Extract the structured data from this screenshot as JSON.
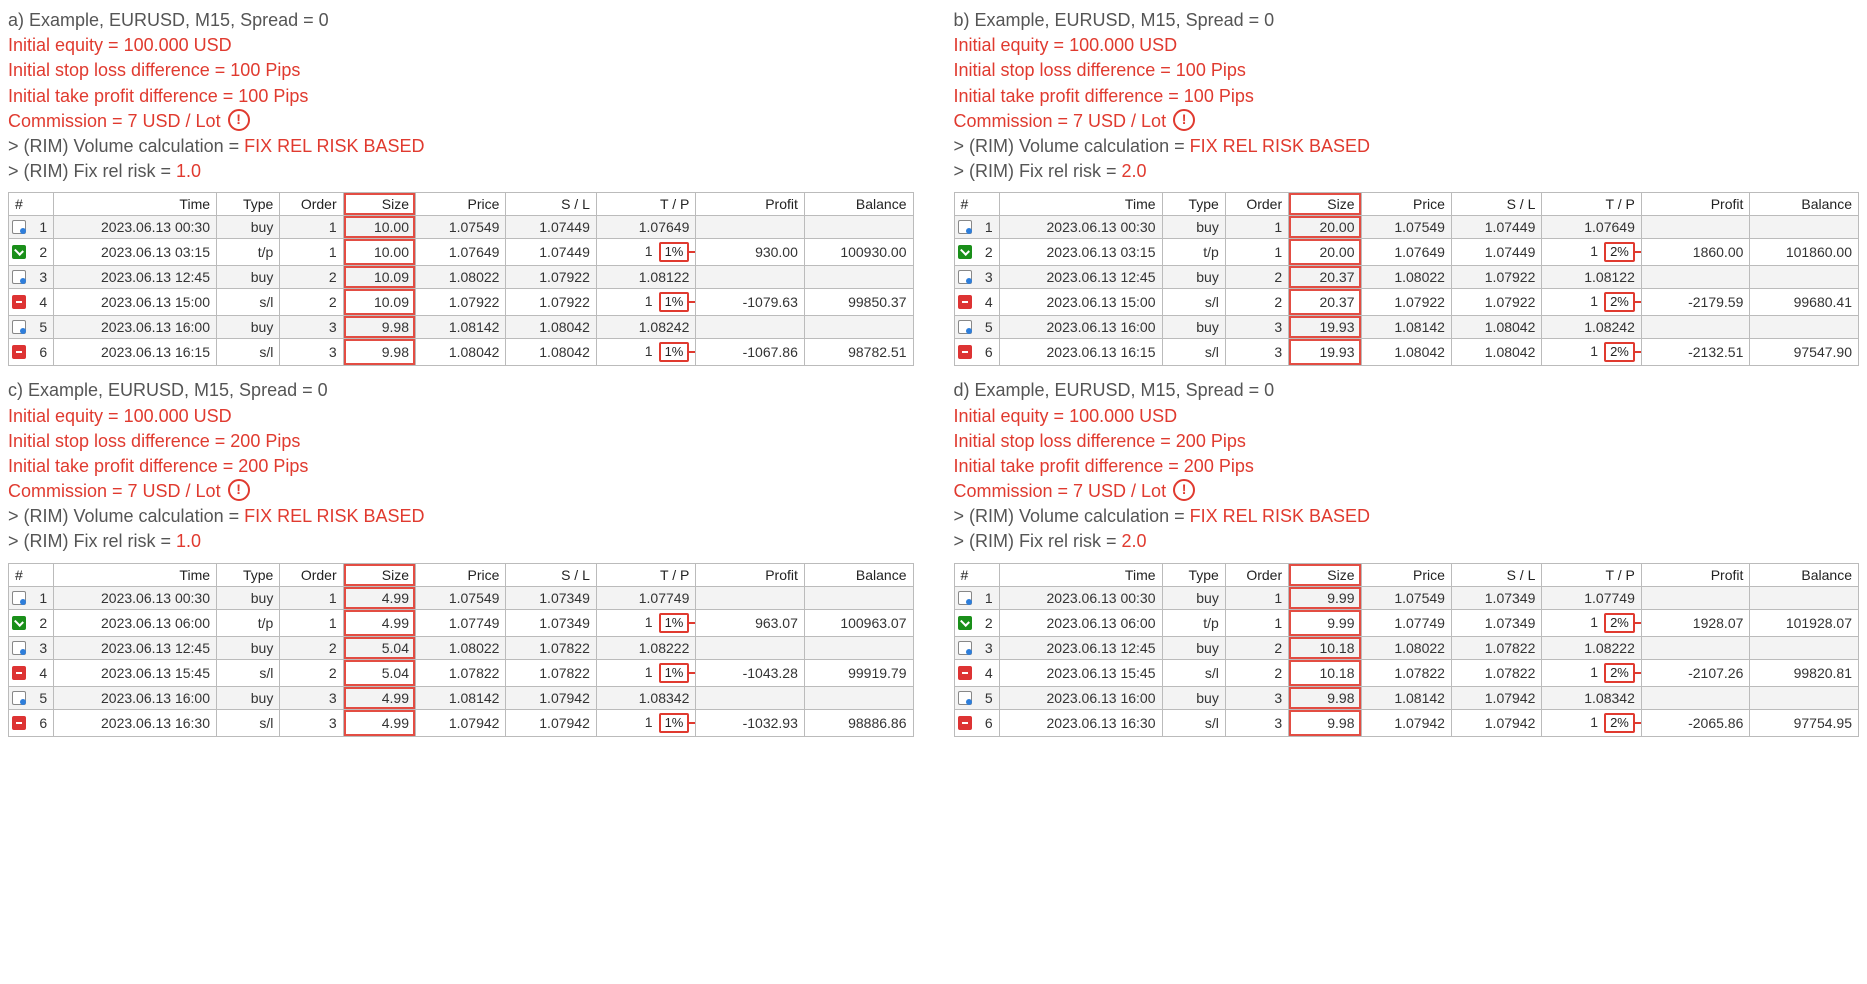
{
  "headers": [
    "#",
    "Time",
    "Type",
    "Order",
    "Size",
    "Price",
    "S / L",
    "T / P",
    "Profit",
    "Balance"
  ],
  "common_params": {
    "equity": "Initial equity = 100.000 USD",
    "commission": "Commission = 7 USD / Lot",
    "vol_prefix": "> (RIM) Volume calculation = ",
    "vol_value": "FIX REL RISK BASED",
    "risk_prefix": "> (RIM) Fix rel risk = "
  },
  "panels": [
    {
      "id": "a",
      "title": "a) Example, EURUSD, M15, Spread = 0",
      "sl_line": "Initial stop loss difference = 100 Pips",
      "tp_line": "Initial take profit difference = 100 Pips",
      "risk": "1.0",
      "pct": "1%",
      "rows": [
        {
          "i": 1,
          "time": "2023.06.13 00:30",
          "type": "buy",
          "ic": "buy",
          "order": "1",
          "size": "10.00",
          "price": "1.07549",
          "sl": "1.07449",
          "tp": "1.07649",
          "annot": false,
          "profit": "",
          "bal": ""
        },
        {
          "i": 2,
          "time": "2023.06.13 03:15",
          "type": "t/p",
          "ic": "tp",
          "order": "1",
          "size": "10.00",
          "price": "1.07649",
          "sl": "1.07449",
          "tp": "1",
          "annot": true,
          "profit": "930.00",
          "bal": "100930.00"
        },
        {
          "i": 3,
          "time": "2023.06.13 12:45",
          "type": "buy",
          "ic": "buy",
          "order": "2",
          "size": "10.09",
          "price": "1.08022",
          "sl": "1.07922",
          "tp": "1.08122",
          "annot": false,
          "profit": "",
          "bal": ""
        },
        {
          "i": 4,
          "time": "2023.06.13 15:00",
          "type": "s/l",
          "ic": "sl",
          "order": "2",
          "size": "10.09",
          "price": "1.07922",
          "sl": "1.07922",
          "tp": "1",
          "annot": true,
          "profit": "-1079.63",
          "bal": "99850.37"
        },
        {
          "i": 5,
          "time": "2023.06.13 16:00",
          "type": "buy",
          "ic": "buy",
          "order": "3",
          "size": "9.98",
          "price": "1.08142",
          "sl": "1.08042",
          "tp": "1.08242",
          "annot": false,
          "profit": "",
          "bal": ""
        },
        {
          "i": 6,
          "time": "2023.06.13 16:15",
          "type": "s/l",
          "ic": "sl",
          "order": "3",
          "size": "9.98",
          "price": "1.08042",
          "sl": "1.08042",
          "tp": "1",
          "annot": true,
          "profit": "-1067.86",
          "bal": "98782.51"
        }
      ]
    },
    {
      "id": "b",
      "title": "b) Example, EURUSD, M15, Spread = 0",
      "sl_line": "Initial stop loss difference = 100 Pips",
      "tp_line": "Initial take profit difference = 100 Pips",
      "risk": "2.0",
      "pct": "2%",
      "rows": [
        {
          "i": 1,
          "time": "2023.06.13 00:30",
          "type": "buy",
          "ic": "buy",
          "order": "1",
          "size": "20.00",
          "price": "1.07549",
          "sl": "1.07449",
          "tp": "1.07649",
          "annot": false,
          "profit": "",
          "bal": ""
        },
        {
          "i": 2,
          "time": "2023.06.13 03:15",
          "type": "t/p",
          "ic": "tp",
          "order": "1",
          "size": "20.00",
          "price": "1.07649",
          "sl": "1.07449",
          "tp": "1",
          "annot": true,
          "profit": "1860.00",
          "bal": "101860.00"
        },
        {
          "i": 3,
          "time": "2023.06.13 12:45",
          "type": "buy",
          "ic": "buy",
          "order": "2",
          "size": "20.37",
          "price": "1.08022",
          "sl": "1.07922",
          "tp": "1.08122",
          "annot": false,
          "profit": "",
          "bal": ""
        },
        {
          "i": 4,
          "time": "2023.06.13 15:00",
          "type": "s/l",
          "ic": "sl",
          "order": "2",
          "size": "20.37",
          "price": "1.07922",
          "sl": "1.07922",
          "tp": "1",
          "annot": true,
          "profit": "-2179.59",
          "bal": "99680.41"
        },
        {
          "i": 5,
          "time": "2023.06.13 16:00",
          "type": "buy",
          "ic": "buy",
          "order": "3",
          "size": "19.93",
          "price": "1.08142",
          "sl": "1.08042",
          "tp": "1.08242",
          "annot": false,
          "profit": "",
          "bal": ""
        },
        {
          "i": 6,
          "time": "2023.06.13 16:15",
          "type": "s/l",
          "ic": "sl",
          "order": "3",
          "size": "19.93",
          "price": "1.08042",
          "sl": "1.08042",
          "tp": "1",
          "annot": true,
          "profit": "-2132.51",
          "bal": "97547.90"
        }
      ]
    },
    {
      "id": "c",
      "title": "c) Example, EURUSD, M15, Spread = 0",
      "sl_line": "Initial stop loss difference = 200 Pips",
      "tp_line": "Initial take profit difference = 200 Pips",
      "risk": "1.0",
      "pct": "1%",
      "rows": [
        {
          "i": 1,
          "time": "2023.06.13 00:30",
          "type": "buy",
          "ic": "buy",
          "order": "1",
          "size": "4.99",
          "price": "1.07549",
          "sl": "1.07349",
          "tp": "1.07749",
          "annot": false,
          "profit": "",
          "bal": ""
        },
        {
          "i": 2,
          "time": "2023.06.13 06:00",
          "type": "t/p",
          "ic": "tp",
          "order": "1",
          "size": "4.99",
          "price": "1.07749",
          "sl": "1.07349",
          "tp": "1",
          "annot": true,
          "profit": "963.07",
          "bal": "100963.07"
        },
        {
          "i": 3,
          "time": "2023.06.13 12:45",
          "type": "buy",
          "ic": "buy",
          "order": "2",
          "size": "5.04",
          "price": "1.08022",
          "sl": "1.07822",
          "tp": "1.08222",
          "annot": false,
          "profit": "",
          "bal": ""
        },
        {
          "i": 4,
          "time": "2023.06.13 15:45",
          "type": "s/l",
          "ic": "sl",
          "order": "2",
          "size": "5.04",
          "price": "1.07822",
          "sl": "1.07822",
          "tp": "1",
          "annot": true,
          "profit": "-1043.28",
          "bal": "99919.79"
        },
        {
          "i": 5,
          "time": "2023.06.13 16:00",
          "type": "buy",
          "ic": "buy",
          "order": "3",
          "size": "4.99",
          "price": "1.08142",
          "sl": "1.07942",
          "tp": "1.08342",
          "annot": false,
          "profit": "",
          "bal": ""
        },
        {
          "i": 6,
          "time": "2023.06.13 16:30",
          "type": "s/l",
          "ic": "sl",
          "order": "3",
          "size": "4.99",
          "price": "1.07942",
          "sl": "1.07942",
          "tp": "1",
          "annot": true,
          "profit": "-1032.93",
          "bal": "98886.86"
        }
      ]
    },
    {
      "id": "d",
      "title": "d) Example, EURUSD, M15, Spread = 0",
      "sl_line": "Initial stop loss difference = 200 Pips",
      "tp_line": "Initial take profit difference = 200 Pips",
      "risk": "2.0",
      "pct": "2%",
      "rows": [
        {
          "i": 1,
          "time": "2023.06.13 00:30",
          "type": "buy",
          "ic": "buy",
          "order": "1",
          "size": "9.99",
          "price": "1.07549",
          "sl": "1.07349",
          "tp": "1.07749",
          "annot": false,
          "profit": "",
          "bal": ""
        },
        {
          "i": 2,
          "time": "2023.06.13 06:00",
          "type": "t/p",
          "ic": "tp",
          "order": "1",
          "size": "9.99",
          "price": "1.07749",
          "sl": "1.07349",
          "tp": "1",
          "annot": true,
          "profit": "1928.07",
          "bal": "101928.07"
        },
        {
          "i": 3,
          "time": "2023.06.13 12:45",
          "type": "buy",
          "ic": "buy",
          "order": "2",
          "size": "10.18",
          "price": "1.08022",
          "sl": "1.07822",
          "tp": "1.08222",
          "annot": false,
          "profit": "",
          "bal": ""
        },
        {
          "i": 4,
          "time": "2023.06.13 15:45",
          "type": "s/l",
          "ic": "sl",
          "order": "2",
          "size": "10.18",
          "price": "1.07822",
          "sl": "1.07822",
          "tp": "1",
          "annot": true,
          "profit": "-2107.26",
          "bal": "99820.81"
        },
        {
          "i": 5,
          "time": "2023.06.13 16:00",
          "type": "buy",
          "ic": "buy",
          "order": "3",
          "size": "9.98",
          "price": "1.08142",
          "sl": "1.07942",
          "tp": "1.08342",
          "annot": false,
          "profit": "",
          "bal": ""
        },
        {
          "i": 6,
          "time": "2023.06.13 16:30",
          "type": "s/l",
          "ic": "sl",
          "order": "3",
          "size": "9.98",
          "price": "1.07942",
          "sl": "1.07942",
          "tp": "1",
          "annot": true,
          "profit": "-2065.86",
          "bal": "97754.95"
        }
      ]
    }
  ]
}
